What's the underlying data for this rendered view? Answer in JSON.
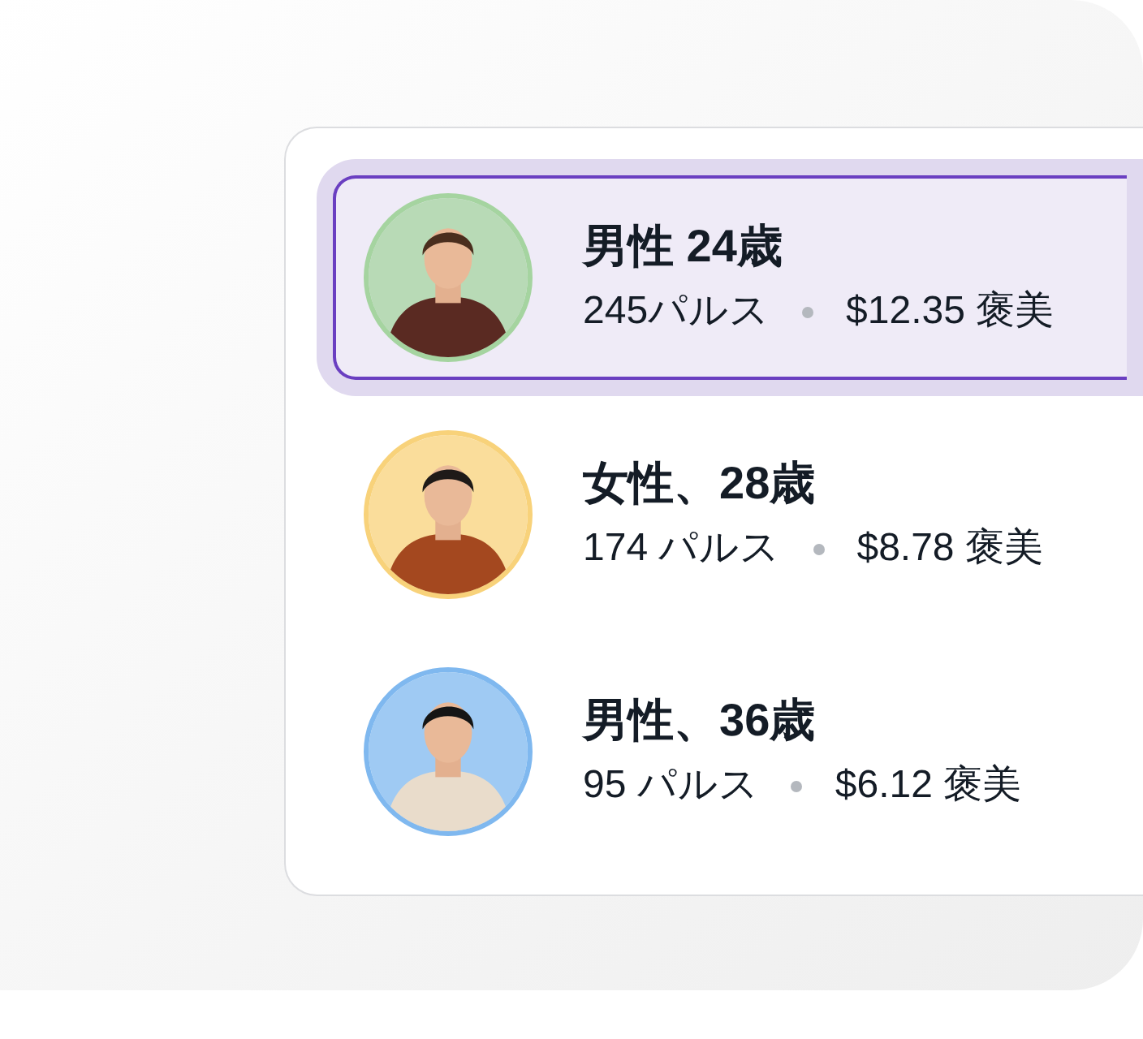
{
  "people": [
    {
      "title": "男性 24歳",
      "pulses": "245パルス",
      "reward": "$12.35 褒美",
      "color": "#a5d4a0",
      "selected": true
    },
    {
      "title": "女性、28歳",
      "pulses": "174 パルス",
      "reward": "$8.78 褒美",
      "color": "#f8d27a",
      "selected": false
    },
    {
      "title": "男性、36歳",
      "pulses": "95 パルス",
      "reward": "$6.12 褒美",
      "color": "#7fb8ef",
      "selected": false
    }
  ]
}
